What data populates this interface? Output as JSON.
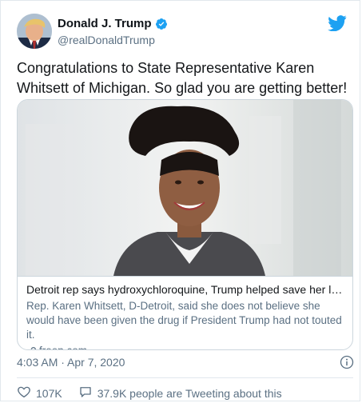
{
  "author": {
    "display_name": "Donald J. Trump",
    "handle": "@realDonaldTrump",
    "verified": true
  },
  "tweet": {
    "text": "Congratulations to State Representative Karen Whitsett of Michigan. So glad you are getting better!"
  },
  "card": {
    "title": "Detroit rep says hydroxychloroquine, Trump helped save her life a...",
    "description": "Rep. Karen Whitsett, D-Detroit, said she does not believe she would have been given the drug if President Trump had not touted it.",
    "domain": "freep.com",
    "domain_icon": "link-icon"
  },
  "meta": {
    "timestamp": "4:03 AM · Apr 7, 2020"
  },
  "actions": {
    "likes": "107K",
    "conversation": "37.9K people are Tweeting about this"
  },
  "colors": {
    "brand_blue": "#1da1f2",
    "secondary_text": "#5b7083",
    "border": "#ccd6dd"
  },
  "icons": [
    "twitter-bird-icon",
    "verified-badge-icon",
    "link-icon",
    "info-icon",
    "heart-icon",
    "speech-bubble-icon"
  ]
}
